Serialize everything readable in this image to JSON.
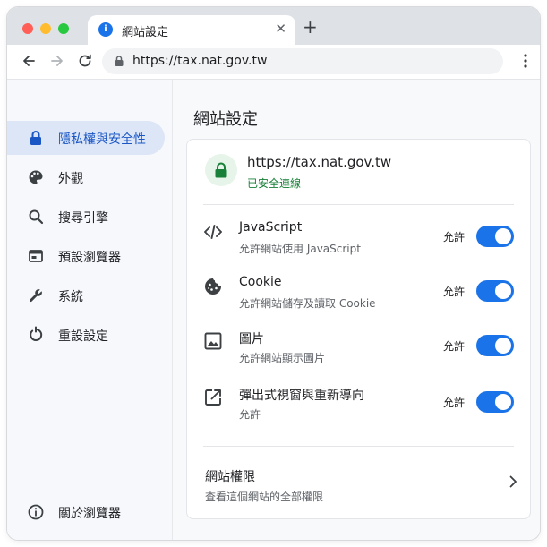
{
  "tab": {
    "title": "網站設定",
    "favicon": "site-favicon-icon"
  },
  "omnibox": {
    "url": "https://tax.nat.gov.tw"
  },
  "sidebar": {
    "items": [
      {
        "label": "隱私權與安全性",
        "icon": "lock-icon",
        "active": true
      },
      {
        "label": "外觀",
        "icon": "palette-icon"
      },
      {
        "label": "搜尋引擎",
        "icon": "search-icon"
      },
      {
        "label": "預設瀏覽器",
        "icon": "browser-icon"
      },
      {
        "label": "系統",
        "icon": "wrench-icon"
      },
      {
        "label": "重設設定",
        "icon": "reset-icon"
      }
    ],
    "about": {
      "label": "關於瀏覽器",
      "icon": "info-icon"
    }
  },
  "main": {
    "title": "網站設定",
    "site": {
      "url": "https://tax.nat.gov.tw",
      "status": "已安全連線"
    },
    "permissions": [
      {
        "name": "JavaScript",
        "desc": "允許網站使用 JavaScript",
        "state": "允許",
        "enabled": true,
        "icon": "code-icon"
      },
      {
        "name": "Cookie",
        "desc": "允許網站儲存及讀取 Cookie",
        "state": "允許",
        "enabled": true,
        "icon": "cookie-icon"
      },
      {
        "name": "圖片",
        "desc": "允許網站顯示圖片",
        "state": "允許",
        "enabled": true,
        "icon": "image-icon"
      },
      {
        "name": "彈出式視窗與重新導向",
        "desc": "允許",
        "state": "允許",
        "enabled": true,
        "icon": "popup-icon"
      }
    ],
    "site_permissions": {
      "name": "網站權限",
      "desc": "查看這個網站的全部權限"
    }
  },
  "colors": {
    "accent": "#1a73e8",
    "secure": "#188038",
    "active_bg": "#dce6f7"
  }
}
